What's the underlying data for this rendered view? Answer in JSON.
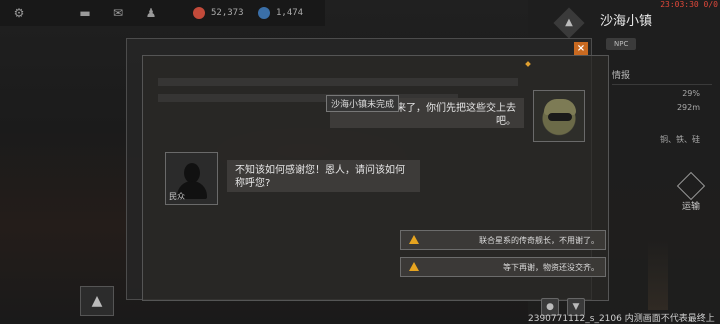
{
  "topbar": {
    "icons": [
      "gear-icon",
      "chat-icon",
      "mail-icon",
      "profile-icon"
    ],
    "res1_value": "52,373",
    "res2_value": "1,474",
    "res1_color": "#c24a3a",
    "res2_color": "#3a6fa8"
  },
  "right_panel": {
    "timer": "23:03:30 0/0",
    "title": "沙海小镇",
    "npc_tag": "NPC",
    "info_label": "情报",
    "stat1": "29%",
    "stat2": "292m",
    "resources": "铜、铁、硅",
    "transport_label": "运输"
  },
  "dialog": {
    "npc_line": "我们东西带来了，你们先把这些交上去吧。",
    "town_tag": "沙海小镇未完成",
    "civ_line": "不知该如何感谢您！恩人，请问该如何称呼您?",
    "civ_name": "民众",
    "close_label": "×"
  },
  "notices": [
    {
      "text": "联合星系的传奇舰长，不用谢了。"
    },
    {
      "text": "等下再谢，物资还没交齐。"
    }
  ],
  "footer": {
    "watermark": "2390771112_s_2106 内测画面不代表最终上线品质"
  }
}
